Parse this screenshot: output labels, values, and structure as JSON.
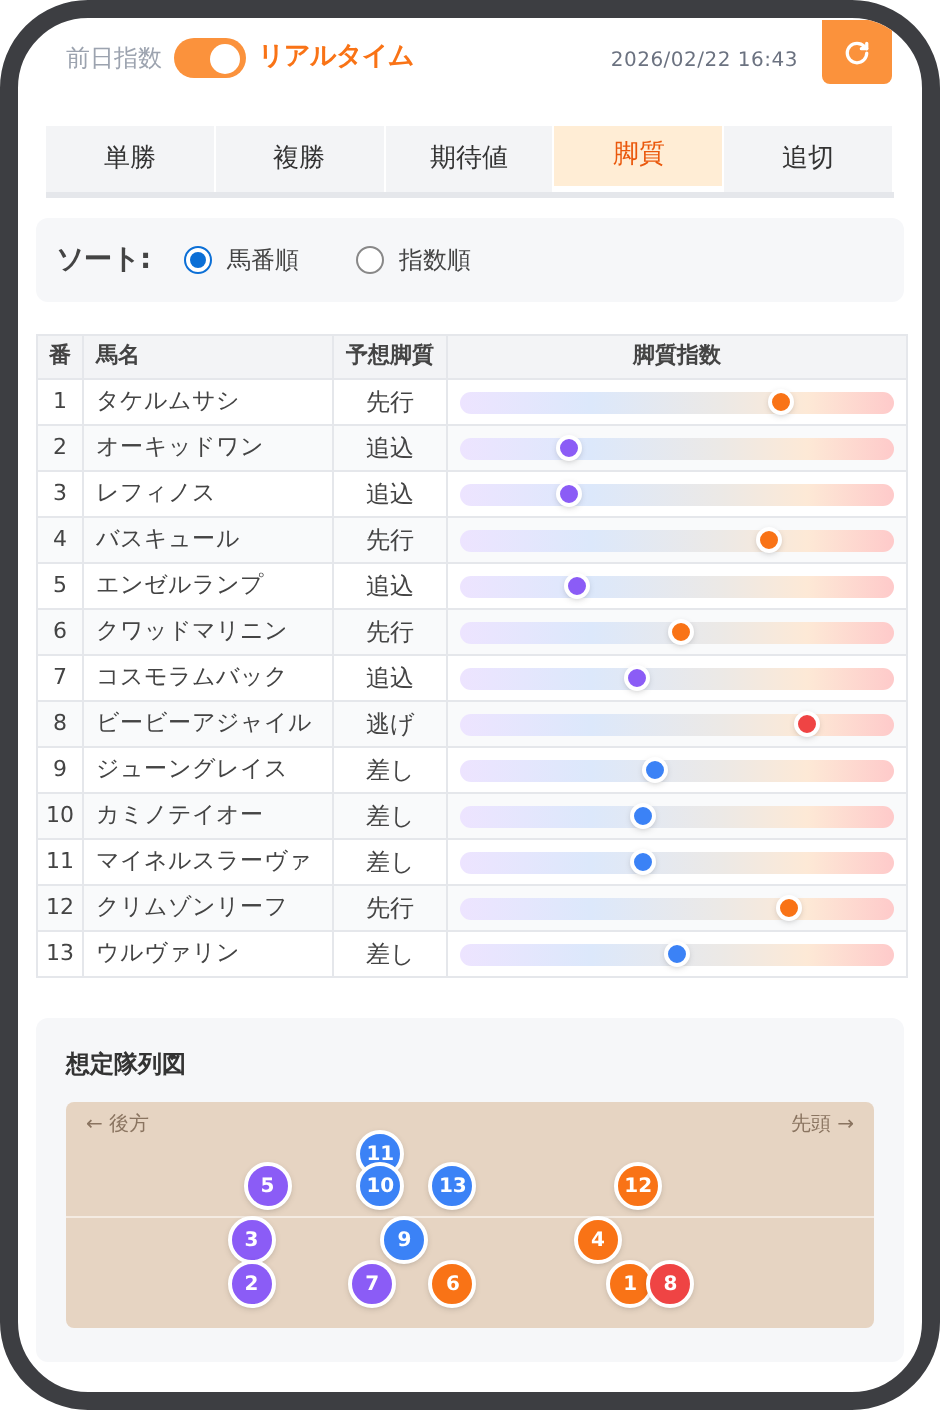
{
  "header": {
    "toggle_left": "前日指数",
    "toggle": {
      "on": true
    },
    "toggle_right": "リアルタイム",
    "datetime": "2026/02/22 16:43"
  },
  "tabs": [
    {
      "label": "単勝",
      "selected": false
    },
    {
      "label": "複勝",
      "selected": false
    },
    {
      "label": "期待値",
      "selected": false
    },
    {
      "label": "脚質",
      "selected": true
    },
    {
      "label": "追切",
      "selected": false
    }
  ],
  "sort": {
    "label": "ソート:",
    "options": [
      {
        "label": "馬番順",
        "selected": true
      },
      {
        "label": "指数順",
        "selected": false
      }
    ]
  },
  "table": {
    "columns": [
      "番",
      "馬名",
      "予想脚質",
      "脚質指数"
    ],
    "rows": [
      {
        "number": "1",
        "name": "タケルムサシ",
        "style": "先行",
        "level": 0.74,
        "color": "#f97316"
      },
      {
        "number": "2",
        "name": "オーキッドワン",
        "style": "追込",
        "level": 0.25,
        "color": "#8b5cf6"
      },
      {
        "number": "3",
        "name": "レフィノス",
        "style": "追込",
        "level": 0.25,
        "color": "#8b5cf6"
      },
      {
        "number": "4",
        "name": "バスキュール",
        "style": "先行",
        "level": 0.71,
        "color": "#f97316"
      },
      {
        "number": "5",
        "name": "エンゼルランプ",
        "style": "追込",
        "level": 0.27,
        "color": "#8b5cf6"
      },
      {
        "number": "6",
        "name": "クワッドマリニン",
        "style": "先行",
        "level": 0.51,
        "color": "#f97316"
      },
      {
        "number": "7",
        "name": "コスモラムバック",
        "style": "追込",
        "level": 0.41,
        "color": "#8b5cf6"
      },
      {
        "number": "8",
        "name": "ビービーアジャイル",
        "style": "逃げ",
        "level": 0.8,
        "color": "#ef4444"
      },
      {
        "number": "9",
        "name": "ジューングレイス",
        "style": "差し",
        "level": 0.45,
        "color": "#3b82f6"
      },
      {
        "number": "10",
        "name": "カミノテイオー",
        "style": "差し",
        "level": 0.42,
        "color": "#3b82f6"
      },
      {
        "number": "11",
        "name": "マイネルスラーヴァ",
        "style": "差し",
        "level": 0.42,
        "color": "#3b82f6"
      },
      {
        "number": "12",
        "name": "クリムゾンリーフ",
        "style": "先行",
        "level": 0.76,
        "color": "#f97316"
      },
      {
        "number": "13",
        "name": "ウルヴァリン",
        "style": "差し",
        "level": 0.5,
        "color": "#3b82f6"
      }
    ]
  },
  "formation": {
    "title": "想定隊列図",
    "rear_label": "← 後方",
    "front_label": "先頭 →",
    "markers": [
      {
        "label": "11",
        "color": "#3b82f6",
        "kind": "top",
        "level": 0.39
      },
      {
        "label": "5",
        "color": "#8b5cf6",
        "kind": "upper",
        "level": 0.25
      },
      {
        "label": "10",
        "color": "#3b82f6",
        "kind": "upper",
        "level": 0.39
      },
      {
        "label": "13",
        "color": "#3b82f6",
        "kind": "upper",
        "level": 0.48
      },
      {
        "label": "12",
        "color": "#f97316",
        "kind": "upper",
        "level": 0.71
      },
      {
        "label": "3",
        "color": "#8b5cf6",
        "kind": "middle",
        "level": 0.23
      },
      {
        "label": "9",
        "color": "#3b82f6",
        "kind": "middle",
        "level": 0.42
      },
      {
        "label": "4",
        "color": "#f97316",
        "kind": "middle",
        "level": 0.66
      },
      {
        "label": "2",
        "color": "#8b5cf6",
        "kind": "bottom",
        "level": 0.23
      },
      {
        "label": "7",
        "color": "#8b5cf6",
        "kind": "bottom",
        "level": 0.38
      },
      {
        "label": "6",
        "color": "#f97316",
        "kind": "bottom",
        "level": 0.48
      },
      {
        "label": "1",
        "color": "#f97316",
        "kind": "bottom",
        "level": 0.7
      },
      {
        "label": "8",
        "color": "#ef4444",
        "kind": "bottom",
        "level": 0.75
      }
    ]
  }
}
